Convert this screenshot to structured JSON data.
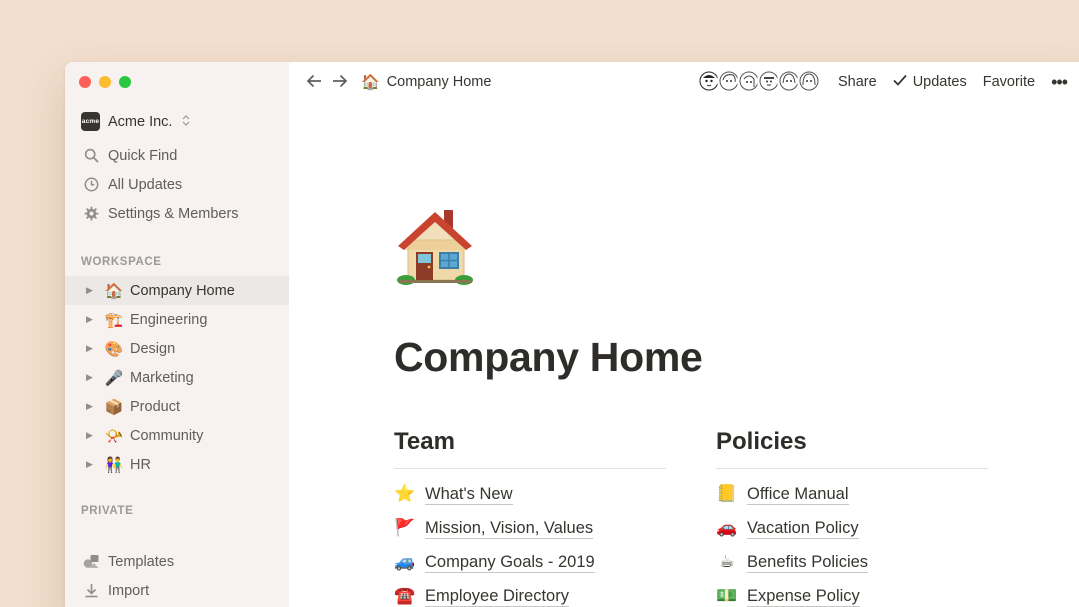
{
  "window": {
    "traffic_lights": [
      "close",
      "minimize",
      "zoom"
    ]
  },
  "sidebar": {
    "workspace": {
      "logo_text": "acme",
      "name": "Acme Inc."
    },
    "nav": [
      {
        "icon": "search-icon",
        "label": "Quick Find"
      },
      {
        "icon": "clock-icon",
        "label": "All Updates"
      },
      {
        "icon": "gear-icon",
        "label": "Settings & Members"
      }
    ],
    "workspace_label": "WORKSPACE",
    "pages": [
      {
        "emoji": "🏠",
        "label": "Company Home",
        "active": true
      },
      {
        "emoji": "🏗️",
        "label": "Engineering"
      },
      {
        "emoji": "🎨",
        "label": "Design"
      },
      {
        "emoji": "🎤",
        "label": "Marketing"
      },
      {
        "emoji": "📦",
        "label": "Product"
      },
      {
        "emoji": "📯",
        "label": "Community"
      },
      {
        "emoji": "👫",
        "label": "HR"
      }
    ],
    "private_label": "PRIVATE",
    "bottom": [
      {
        "icon": "templates-icon",
        "label": "Templates"
      },
      {
        "icon": "import-icon",
        "label": "Import"
      }
    ]
  },
  "topbar": {
    "breadcrumb": {
      "emoji": "🏠",
      "label": "Company Home"
    },
    "share_label": "Share",
    "updates_label": "Updates",
    "favorite_label": "Favorite",
    "more_label": "•••"
  },
  "page": {
    "title": "Company Home",
    "columns": [
      {
        "heading": "Team",
        "links": [
          {
            "emoji": "⭐",
            "label": "What's New"
          },
          {
            "emoji": "🚩",
            "label": "Mission, Vision, Values"
          },
          {
            "emoji": "🚙",
            "label": "Company Goals - 2019"
          },
          {
            "emoji": "☎️",
            "label": "Employee Directory"
          }
        ]
      },
      {
        "heading": "Policies",
        "links": [
          {
            "emoji": "📒",
            "label": "Office Manual"
          },
          {
            "emoji": "🚗",
            "label": "Vacation Policy"
          },
          {
            "emoji": "☕",
            "label": "Benefits Policies"
          },
          {
            "emoji": "💵",
            "label": "Expense Policy"
          }
        ]
      }
    ]
  },
  "colors": {
    "background": "#f3dfce",
    "sidebar": "#f7f1ef",
    "active_item": "#ece8e5",
    "text": "#37352f"
  }
}
